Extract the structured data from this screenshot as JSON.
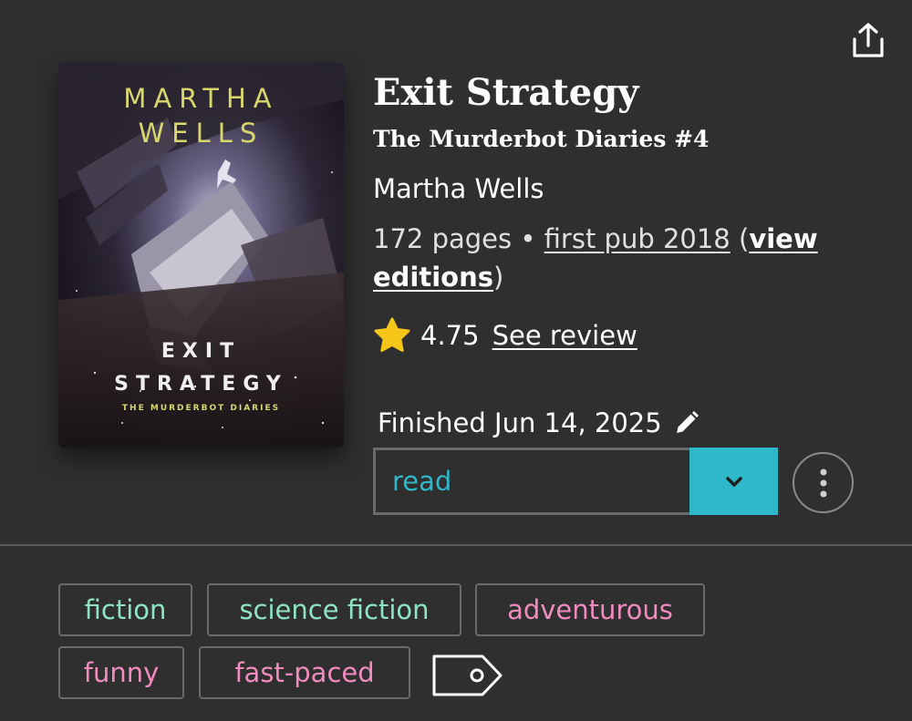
{
  "header": {
    "share_icon": "share-icon"
  },
  "cover": {
    "author_line1": "MARTHA",
    "author_line2": "WELLS",
    "title_line1": "EXIT",
    "title_line2": "STRATEGY",
    "series_line": "THE MURDERBOT DIARIES"
  },
  "book": {
    "title": "Exit Strategy",
    "series": "The Murderbot Diaries #4",
    "author": "Martha Wells",
    "pages": "172 pages",
    "separator": " • ",
    "first_pub": "first pub 2018",
    "paren_open": " (",
    "view_editions": "view editions",
    "paren_close": ")"
  },
  "rating": {
    "star_icon": "star-icon",
    "score": "4.75",
    "see_review": "See review"
  },
  "reading": {
    "finished_label": "Finished Jun 14, 2025",
    "edit_icon": "pencil-icon",
    "status_value": "read",
    "dropdown_icon": "chevron-down-icon",
    "more_icon": "more-vertical-icon"
  },
  "tags": {
    "genres": [
      "fiction",
      "science fiction"
    ],
    "moods": [
      "adventurous",
      "funny",
      "fast-paced"
    ],
    "tag_icon": "tag-icon"
  },
  "colors": {
    "background": "#2f2f2f",
    "accent": "#2fb8c9",
    "genre_tag": "#8ee3c0",
    "mood_tag": "#f08bc0",
    "star": "#f5c518"
  }
}
